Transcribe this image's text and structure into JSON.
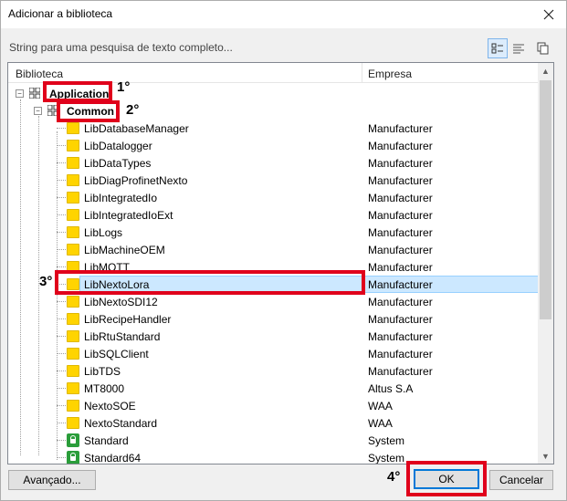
{
  "window": {
    "title": "Adicionar a biblioteca"
  },
  "search": {
    "placeholder": "String para uma pesquisa de texto completo..."
  },
  "tree": {
    "columns": {
      "library": "Biblioteca",
      "company": "Empresa"
    },
    "root": {
      "label": "Application"
    },
    "group": {
      "label": "Common"
    },
    "items": [
      {
        "name": "LibDatabaseManager",
        "company": "Manufacturer",
        "icon": "folder"
      },
      {
        "name": "LibDatalogger",
        "company": "Manufacturer",
        "icon": "folder"
      },
      {
        "name": "LibDataTypes",
        "company": "Manufacturer",
        "icon": "folder"
      },
      {
        "name": "LibDiagProfinetNexto",
        "company": "Manufacturer",
        "icon": "folder"
      },
      {
        "name": "LibIntegratedIo",
        "company": "Manufacturer",
        "icon": "folder"
      },
      {
        "name": "LibIntegratedIoExt",
        "company": "Manufacturer",
        "icon": "folder"
      },
      {
        "name": "LibLogs",
        "company": "Manufacturer",
        "icon": "folder"
      },
      {
        "name": "LibMachineOEM",
        "company": "Manufacturer",
        "icon": "folder"
      },
      {
        "name": "LibMQTT",
        "company": "Manufacturer",
        "icon": "folder"
      },
      {
        "name": "LibNextoLora",
        "company": "Manufacturer",
        "icon": "folder",
        "selected": true
      },
      {
        "name": "LibNextoSDI12",
        "company": "Manufacturer",
        "icon": "folder"
      },
      {
        "name": "LibRecipeHandler",
        "company": "Manufacturer",
        "icon": "folder"
      },
      {
        "name": "LibRtuStandard",
        "company": "Manufacturer",
        "icon": "folder"
      },
      {
        "name": "LibSQLClient",
        "company": "Manufacturer",
        "icon": "folder"
      },
      {
        "name": "LibTDS",
        "company": "Manufacturer",
        "icon": "folder"
      },
      {
        "name": "MT8000",
        "company": "Altus S.A",
        "icon": "folder"
      },
      {
        "name": "NextoSOE",
        "company": "WAA",
        "icon": "folder"
      },
      {
        "name": "NextoStandard",
        "company": "WAA",
        "icon": "folder"
      },
      {
        "name": "Standard",
        "company": "System",
        "icon": "lock"
      },
      {
        "name": "Standard64",
        "company": "System",
        "icon": "lock"
      }
    ]
  },
  "annotations": {
    "step1": "1°",
    "step2": "2°",
    "step3": "3°",
    "step4": "4°"
  },
  "buttons": {
    "advanced": "Avançado...",
    "ok": "OK",
    "cancel": "Cancelar"
  },
  "colors": {
    "highlight": "#e0001b",
    "selection": "#cce8ff",
    "folder": "#ffd400",
    "lock": "#2a9d3a"
  }
}
